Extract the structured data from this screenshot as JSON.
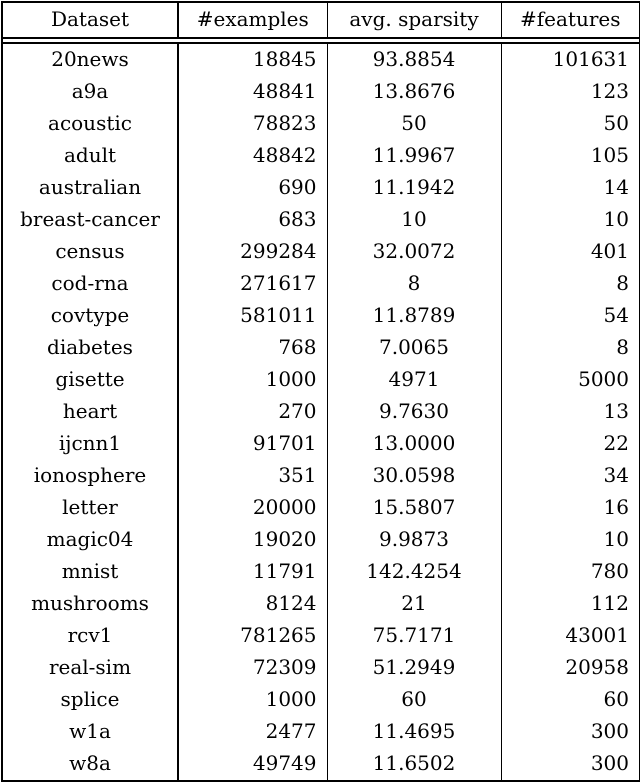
{
  "table": {
    "columns": [
      {
        "key": "dataset",
        "label": "Dataset",
        "align": "center"
      },
      {
        "key": "examples",
        "label": "#examples",
        "align": "right"
      },
      {
        "key": "sparsity",
        "label": "avg. sparsity",
        "align": "center"
      },
      {
        "key": "features",
        "label": "#features",
        "align": "right"
      }
    ],
    "rows": [
      {
        "dataset": "20news",
        "examples": "18845",
        "sparsity": "93.8854",
        "features": "101631"
      },
      {
        "dataset": "a9a",
        "examples": "48841",
        "sparsity": "13.8676",
        "features": "123"
      },
      {
        "dataset": "acoustic",
        "examples": "78823",
        "sparsity": "50",
        "features": "50"
      },
      {
        "dataset": "adult",
        "examples": "48842",
        "sparsity": "11.9967",
        "features": "105"
      },
      {
        "dataset": "australian",
        "examples": "690",
        "sparsity": "11.1942",
        "features": "14"
      },
      {
        "dataset": "breast-cancer",
        "examples": "683",
        "sparsity": "10",
        "features": "10"
      },
      {
        "dataset": "census",
        "examples": "299284",
        "sparsity": "32.0072",
        "features": "401"
      },
      {
        "dataset": "cod-rna",
        "examples": "271617",
        "sparsity": "8",
        "features": "8"
      },
      {
        "dataset": "covtype",
        "examples": "581011",
        "sparsity": "11.8789",
        "features": "54"
      },
      {
        "dataset": "diabetes",
        "examples": "768",
        "sparsity": "7.0065",
        "features": "8"
      },
      {
        "dataset": "gisette",
        "examples": "1000",
        "sparsity": "4971",
        "features": "5000"
      },
      {
        "dataset": "heart",
        "examples": "270",
        "sparsity": "9.7630",
        "features": "13"
      },
      {
        "dataset": "ijcnn1",
        "examples": "91701",
        "sparsity": "13.0000",
        "features": "22"
      },
      {
        "dataset": "ionosphere",
        "examples": "351",
        "sparsity": "30.0598",
        "features": "34"
      },
      {
        "dataset": "letter",
        "examples": "20000",
        "sparsity": "15.5807",
        "features": "16"
      },
      {
        "dataset": "magic04",
        "examples": "19020",
        "sparsity": "9.9873",
        "features": "10"
      },
      {
        "dataset": "mnist",
        "examples": "11791",
        "sparsity": "142.4254",
        "features": "780"
      },
      {
        "dataset": "mushrooms",
        "examples": "8124",
        "sparsity": "21",
        "features": "112"
      },
      {
        "dataset": "rcv1",
        "examples": "781265",
        "sparsity": "75.7171",
        "features": "43001"
      },
      {
        "dataset": "real-sim",
        "examples": "72309",
        "sparsity": "51.2949",
        "features": "20958"
      },
      {
        "dataset": "splice",
        "examples": "1000",
        "sparsity": "60",
        "features": "60"
      },
      {
        "dataset": "w1a",
        "examples": "2477",
        "sparsity": "11.4695",
        "features": "300"
      },
      {
        "dataset": "w8a",
        "examples": "49749",
        "sparsity": "11.6502",
        "features": "300"
      }
    ]
  },
  "style": {
    "rule_color": "#000000",
    "background": "#ffffff",
    "text_color": "#000000"
  }
}
